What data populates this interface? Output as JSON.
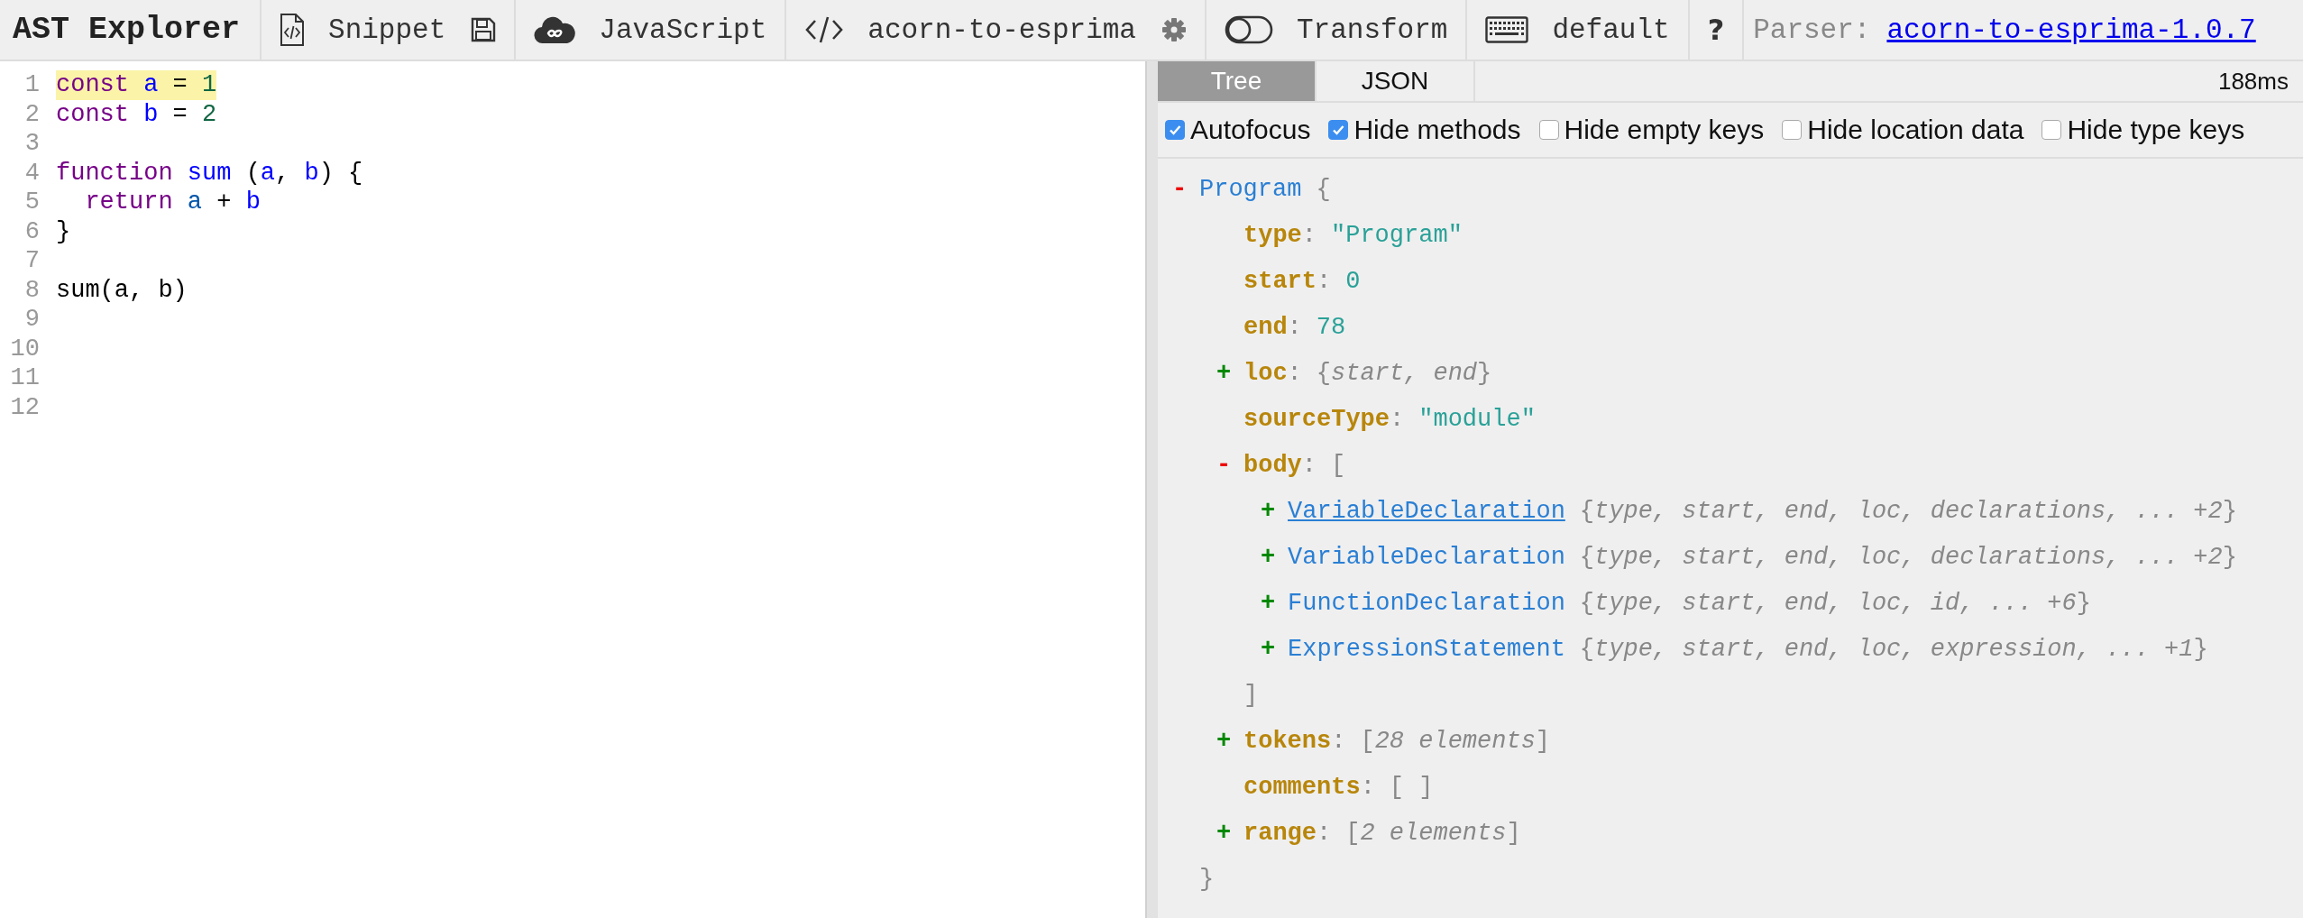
{
  "toolbar": {
    "title": "AST Explorer",
    "groups": [
      {
        "items": [
          {
            "kind": "file-code",
            "label": "Snippet"
          },
          {
            "kind": "save"
          }
        ]
      },
      {
        "items": [
          {
            "kind": "cloud",
            "label": "JavaScript"
          }
        ]
      },
      {
        "items": [
          {
            "kind": "code",
            "label": "acorn-to-esprima"
          },
          {
            "kind": "gear"
          }
        ]
      },
      {
        "items": [
          {
            "kind": "toggle",
            "label": "Transform",
            "on": false
          }
        ]
      },
      {
        "items": [
          {
            "kind": "keyboard",
            "label": "default"
          }
        ]
      },
      {
        "items": [
          {
            "kind": "help",
            "label": "?"
          }
        ]
      }
    ],
    "parser_label": "Parser:",
    "parser_link": "acorn-to-esprima-1.0.7"
  },
  "editor": {
    "lines": [
      {
        "number": "1",
        "highlighted": true,
        "tokens": [
          {
            "text": "const ",
            "kind": "keyword"
          },
          {
            "text": "a",
            "kind": "def"
          },
          {
            "text": " = ",
            "kind": "plain"
          },
          {
            "text": "1",
            "kind": "number"
          }
        ]
      },
      {
        "number": "2",
        "tokens": [
          {
            "text": "const ",
            "kind": "keyword"
          },
          {
            "text": "b",
            "kind": "def"
          },
          {
            "text": " = ",
            "kind": "plain"
          },
          {
            "text": "2",
            "kind": "number"
          }
        ]
      },
      {
        "number": "3"
      },
      {
        "number": "4",
        "tokens": [
          {
            "text": "function ",
            "kind": "keyword"
          },
          {
            "text": "sum",
            "kind": "def"
          },
          {
            "text": " (",
            "kind": "plain"
          },
          {
            "text": "a",
            "kind": "def"
          },
          {
            "text": ", ",
            "kind": "plain"
          },
          {
            "text": "b",
            "kind": "def"
          },
          {
            "text": ") {",
            "kind": "plain"
          }
        ]
      },
      {
        "number": "5",
        "tokens": [
          {
            "text": "  return ",
            "kind": "keyword"
          },
          {
            "text": "a",
            "kind": "variable"
          },
          {
            "text": " + ",
            "kind": "plain"
          },
          {
            "text": "b",
            "kind": "def"
          }
        ]
      },
      {
        "number": "6",
        "tokens": [
          {
            "text": "}",
            "kind": "plain"
          }
        ]
      },
      {
        "number": "7"
      },
      {
        "number": "8",
        "tokens": [
          {
            "text": "sum(a, b)",
            "kind": "plain"
          }
        ]
      },
      {
        "number": "9"
      },
      {
        "number": "10"
      },
      {
        "number": "11"
      },
      {
        "number": "12"
      }
    ]
  },
  "output": {
    "tabs": [
      {
        "label": "Tree",
        "selected": true
      },
      {
        "label": "JSON",
        "selected": false
      }
    ],
    "time": "188ms",
    "options": [
      {
        "label": "Autofocus",
        "checked": true
      },
      {
        "label": "Hide methods",
        "checked": true
      },
      {
        "label": "Hide empty keys",
        "checked": false
      },
      {
        "label": "Hide location data",
        "checked": false
      },
      {
        "label": "Hide type keys",
        "checked": false
      }
    ],
    "tree": {
      "kind": "node",
      "toggle": "-",
      "expanded": true,
      "label": "Program",
      "hovered": false,
      "open": "{",
      "close": "}",
      "children": [
        {
          "kind": "value",
          "key": "type",
          "sep": ":",
          "value": "\"Program\""
        },
        {
          "kind": "value",
          "key": "start",
          "sep": ":",
          "value": "0"
        },
        {
          "kind": "value",
          "key": "end",
          "sep": ":",
          "value": "78"
        },
        {
          "kind": "branch",
          "toggle": "+",
          "expanded": false,
          "label": "loc",
          "sep": ":",
          "open": "{",
          "summary": "start, end",
          "close": "}"
        },
        {
          "kind": "value",
          "key": "sourceType",
          "sep": ":",
          "value": "\"module\""
        },
        {
          "kind": "branch",
          "toggle": "-",
          "expanded": true,
          "label": "body",
          "sep": ":",
          "open": "[",
          "close": "]",
          "children": [
            {
              "kind": "node",
              "toggle": "+",
              "expanded": false,
              "label": "VariableDeclaration",
              "hovered": true,
              "open": "{",
              "summary": "type, start, end, loc, declarations, ... +2",
              "close": "}"
            },
            {
              "kind": "node",
              "toggle": "+",
              "expanded": false,
              "label": "VariableDeclaration",
              "hovered": false,
              "open": "{",
              "summary": "type, start, end, loc, declarations, ... +2",
              "close": "}"
            },
            {
              "kind": "node",
              "toggle": "+",
              "expanded": false,
              "label": "FunctionDeclaration",
              "hovered": false,
              "open": "{",
              "summary": "type, start, end, loc, id, ... +6",
              "close": "}"
            },
            {
              "kind": "node",
              "toggle": "+",
              "expanded": false,
              "label": "ExpressionStatement",
              "hovered": false,
              "open": "{",
              "summary": "type, start, end, loc, expression, ... +1",
              "close": "}"
            }
          ]
        },
        {
          "kind": "branch",
          "toggle": "+",
          "expanded": false,
          "label": "tokens",
          "sep": ":",
          "open": "[",
          "summary": "28 elements",
          "close": "]"
        },
        {
          "kind": "empty",
          "key": "comments",
          "sep": ":",
          "value": "[ ]"
        },
        {
          "kind": "branch",
          "toggle": "+",
          "expanded": false,
          "label": "range",
          "sep": ":",
          "open": "[",
          "summary": "2 elements",
          "close": "]"
        }
      ]
    }
  }
}
